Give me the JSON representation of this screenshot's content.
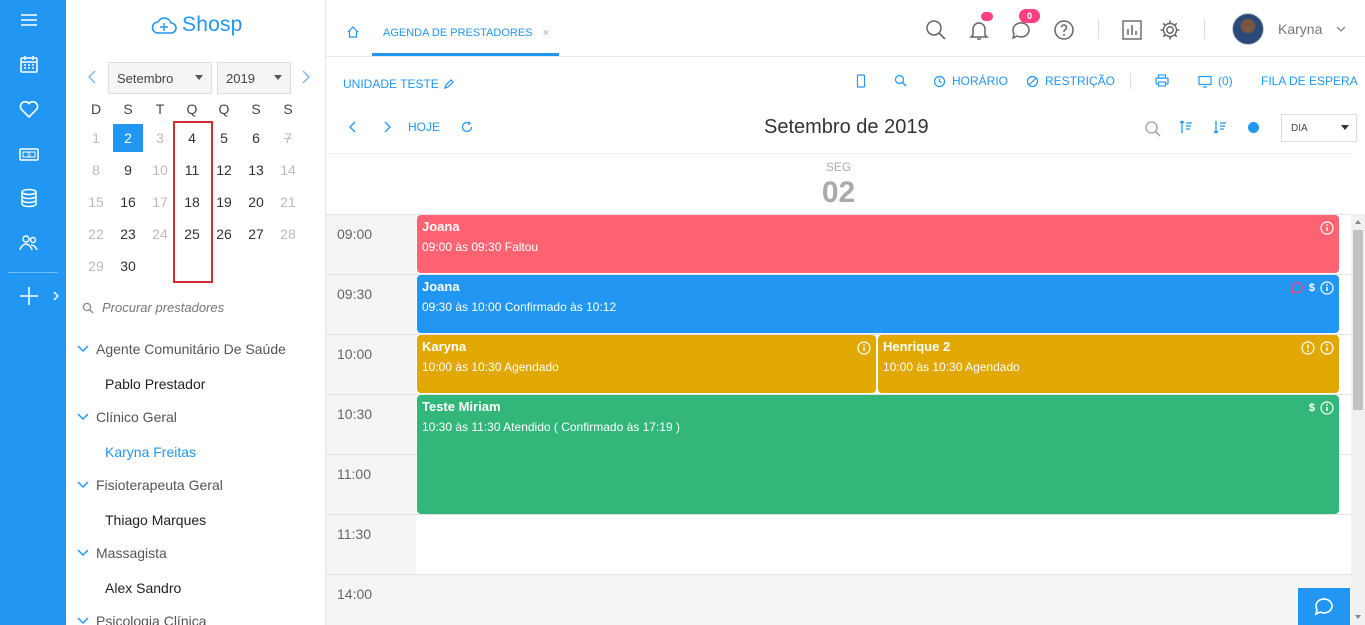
{
  "brand": {
    "name": "Shosp"
  },
  "rail": {
    "icons": [
      "menu-icon",
      "calendar-icon",
      "heart-icon",
      "money-icon",
      "database-icon",
      "users-icon",
      "plus-icon"
    ]
  },
  "mini_calendar": {
    "month": "Setembro",
    "year": "2019",
    "weekdays": [
      "D",
      "S",
      "T",
      "Q",
      "Q",
      "S",
      "S"
    ],
    "weeks": [
      [
        "1",
        "2",
        "3",
        "4",
        "5",
        "6",
        "7"
      ],
      [
        "8",
        "9",
        "10",
        "11",
        "12",
        "13",
        "14"
      ],
      [
        "15",
        "16",
        "17",
        "18",
        "19",
        "20",
        "21"
      ],
      [
        "22",
        "23",
        "24",
        "25",
        "26",
        "27",
        "28"
      ],
      [
        "29",
        "30",
        "",
        "",
        "",
        "",
        ""
      ]
    ],
    "selected_day": "2"
  },
  "search": {
    "placeholder": "Procurar prestadores"
  },
  "groups": [
    {
      "name": "Agente Comunitário De Saúde",
      "provider": "Pablo Prestador"
    },
    {
      "name": "Clínico Geral",
      "provider": "Karyna Freitas"
    },
    {
      "name": "Fisioterapeuta Geral",
      "provider": "Thiago Marques"
    },
    {
      "name": "Massagista",
      "provider": "Alex Sandro"
    },
    {
      "name": "Psicologia Clínica",
      "provider": ""
    }
  ],
  "header": {
    "tab_label": "AGENDA DE PRESTADORES",
    "tab_close": "×",
    "notification_badge": "",
    "messages_badge": "0",
    "user_name": "Karyna"
  },
  "toolbar": {
    "unit": "UNIDADE TESTE",
    "horario": "HORÁRIO",
    "restricao": "RESTRIÇÃO",
    "waiting_count": "(0)",
    "fila": "FILA DE ESPERA"
  },
  "calendar_nav": {
    "today": "HOJE",
    "title": "Setembro de 2019",
    "view": "DIA"
  },
  "day": {
    "name": "SEG",
    "number": "02"
  },
  "time_slots": [
    "09:00",
    "09:30",
    "10:00",
    "10:30",
    "11:00",
    "11:30",
    "14:00"
  ],
  "events": [
    {
      "name": "Joana",
      "desc": "09:00 às 09:30 Faltou",
      "color": "#ff6372"
    },
    {
      "name": "Joana",
      "desc": "09:30 às 10:00 Confirmado às 10:12",
      "color": "#2196f3"
    },
    {
      "name": "Karyna",
      "desc": "10:00 às 10:30 Agendado",
      "color": "#e0a800"
    },
    {
      "name": "Henrique 2",
      "desc": "10:00 às 10:30 Agendado",
      "color": "#e0a800"
    },
    {
      "name": "Teste Miriam",
      "desc": "10:30 às 11:30 Atendido ( Confirmado às 17:19 )",
      "color": "#33b679"
    }
  ],
  "dollar_sign": "$"
}
